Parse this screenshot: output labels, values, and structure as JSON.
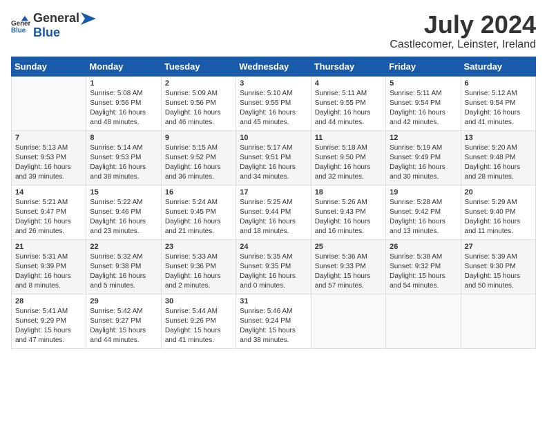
{
  "header": {
    "logo_general": "General",
    "logo_blue": "Blue",
    "title": "July 2024",
    "location": "Castlecomer, Leinster, Ireland"
  },
  "days_of_week": [
    "Sunday",
    "Monday",
    "Tuesday",
    "Wednesday",
    "Thursday",
    "Friday",
    "Saturday"
  ],
  "weeks": [
    {
      "days": [
        {
          "num": "",
          "info": ""
        },
        {
          "num": "1",
          "info": "Sunrise: 5:08 AM\nSunset: 9:56 PM\nDaylight: 16 hours\nand 48 minutes."
        },
        {
          "num": "2",
          "info": "Sunrise: 5:09 AM\nSunset: 9:56 PM\nDaylight: 16 hours\nand 46 minutes."
        },
        {
          "num": "3",
          "info": "Sunrise: 5:10 AM\nSunset: 9:55 PM\nDaylight: 16 hours\nand 45 minutes."
        },
        {
          "num": "4",
          "info": "Sunrise: 5:11 AM\nSunset: 9:55 PM\nDaylight: 16 hours\nand 44 minutes."
        },
        {
          "num": "5",
          "info": "Sunrise: 5:11 AM\nSunset: 9:54 PM\nDaylight: 16 hours\nand 42 minutes."
        },
        {
          "num": "6",
          "info": "Sunrise: 5:12 AM\nSunset: 9:54 PM\nDaylight: 16 hours\nand 41 minutes."
        }
      ]
    },
    {
      "days": [
        {
          "num": "7",
          "info": "Sunrise: 5:13 AM\nSunset: 9:53 PM\nDaylight: 16 hours\nand 39 minutes."
        },
        {
          "num": "8",
          "info": "Sunrise: 5:14 AM\nSunset: 9:53 PM\nDaylight: 16 hours\nand 38 minutes."
        },
        {
          "num": "9",
          "info": "Sunrise: 5:15 AM\nSunset: 9:52 PM\nDaylight: 16 hours\nand 36 minutes."
        },
        {
          "num": "10",
          "info": "Sunrise: 5:17 AM\nSunset: 9:51 PM\nDaylight: 16 hours\nand 34 minutes."
        },
        {
          "num": "11",
          "info": "Sunrise: 5:18 AM\nSunset: 9:50 PM\nDaylight: 16 hours\nand 32 minutes."
        },
        {
          "num": "12",
          "info": "Sunrise: 5:19 AM\nSunset: 9:49 PM\nDaylight: 16 hours\nand 30 minutes."
        },
        {
          "num": "13",
          "info": "Sunrise: 5:20 AM\nSunset: 9:48 PM\nDaylight: 16 hours\nand 28 minutes."
        }
      ]
    },
    {
      "days": [
        {
          "num": "14",
          "info": "Sunrise: 5:21 AM\nSunset: 9:47 PM\nDaylight: 16 hours\nand 26 minutes."
        },
        {
          "num": "15",
          "info": "Sunrise: 5:22 AM\nSunset: 9:46 PM\nDaylight: 16 hours\nand 23 minutes."
        },
        {
          "num": "16",
          "info": "Sunrise: 5:24 AM\nSunset: 9:45 PM\nDaylight: 16 hours\nand 21 minutes."
        },
        {
          "num": "17",
          "info": "Sunrise: 5:25 AM\nSunset: 9:44 PM\nDaylight: 16 hours\nand 18 minutes."
        },
        {
          "num": "18",
          "info": "Sunrise: 5:26 AM\nSunset: 9:43 PM\nDaylight: 16 hours\nand 16 minutes."
        },
        {
          "num": "19",
          "info": "Sunrise: 5:28 AM\nSunset: 9:42 PM\nDaylight: 16 hours\nand 13 minutes."
        },
        {
          "num": "20",
          "info": "Sunrise: 5:29 AM\nSunset: 9:40 PM\nDaylight: 16 hours\nand 11 minutes."
        }
      ]
    },
    {
      "days": [
        {
          "num": "21",
          "info": "Sunrise: 5:31 AM\nSunset: 9:39 PM\nDaylight: 16 hours\nand 8 minutes."
        },
        {
          "num": "22",
          "info": "Sunrise: 5:32 AM\nSunset: 9:38 PM\nDaylight: 16 hours\nand 5 minutes."
        },
        {
          "num": "23",
          "info": "Sunrise: 5:33 AM\nSunset: 9:36 PM\nDaylight: 16 hours\nand 2 minutes."
        },
        {
          "num": "24",
          "info": "Sunrise: 5:35 AM\nSunset: 9:35 PM\nDaylight: 16 hours\nand 0 minutes."
        },
        {
          "num": "25",
          "info": "Sunrise: 5:36 AM\nSunset: 9:33 PM\nDaylight: 15 hours\nand 57 minutes."
        },
        {
          "num": "26",
          "info": "Sunrise: 5:38 AM\nSunset: 9:32 PM\nDaylight: 15 hours\nand 54 minutes."
        },
        {
          "num": "27",
          "info": "Sunrise: 5:39 AM\nSunset: 9:30 PM\nDaylight: 15 hours\nand 50 minutes."
        }
      ]
    },
    {
      "days": [
        {
          "num": "28",
          "info": "Sunrise: 5:41 AM\nSunset: 9:29 PM\nDaylight: 15 hours\nand 47 minutes."
        },
        {
          "num": "29",
          "info": "Sunrise: 5:42 AM\nSunset: 9:27 PM\nDaylight: 15 hours\nand 44 minutes."
        },
        {
          "num": "30",
          "info": "Sunrise: 5:44 AM\nSunset: 9:26 PM\nDaylight: 15 hours\nand 41 minutes."
        },
        {
          "num": "31",
          "info": "Sunrise: 5:46 AM\nSunset: 9:24 PM\nDaylight: 15 hours\nand 38 minutes."
        },
        {
          "num": "",
          "info": ""
        },
        {
          "num": "",
          "info": ""
        },
        {
          "num": "",
          "info": ""
        }
      ]
    }
  ]
}
